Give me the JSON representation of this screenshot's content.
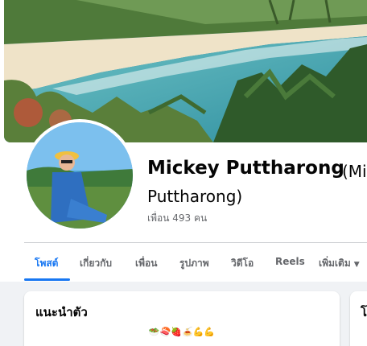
{
  "profile": {
    "name": "Mickey Puttharong",
    "alt_name_open": "(Mi",
    "alt_name_close": "Puttharong)",
    "friends_label": "เพื่อน 493 คน"
  },
  "tabs": [
    {
      "label": "โพสต์",
      "active": true
    },
    {
      "label": "เกี่ยวกับ",
      "active": false
    },
    {
      "label": "เพื่อน",
      "active": false
    },
    {
      "label": "รูปภาพ",
      "active": false
    },
    {
      "label": "วิดีโอ",
      "active": false
    },
    {
      "label": "Reels",
      "active": false
    },
    {
      "label": "เพิ่มเติม",
      "active": false
    }
  ],
  "intro": {
    "title": "แนะนำตัว",
    "bio": "🥗🍣🍓🍝💪💪"
  },
  "right_card": {
    "title_partial": "โ"
  },
  "colors": {
    "accent": "#1877f2",
    "text": "#050505",
    "secondary_text": "#65676b",
    "background": "#f0f2f5"
  },
  "icons": {
    "more_tab": "chevron-down-icon"
  }
}
